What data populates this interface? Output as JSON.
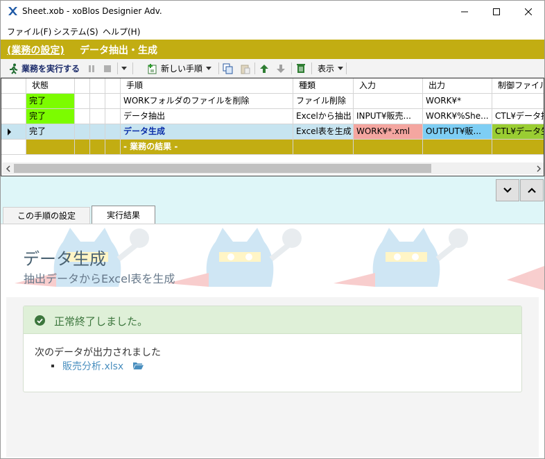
{
  "window": {
    "title": "Sheet.xob - xoBlos Designier Adv."
  },
  "menu": [
    {
      "label": "ファイル(F)"
    },
    {
      "label": "システム(S)"
    },
    {
      "label": "ヘルプ(H)"
    }
  ],
  "header": {
    "link": "(業務の設定)",
    "title": "データ抽出・生成"
  },
  "toolbar": {
    "run_label": "業務を実行する",
    "new_step_label": "新しい手順",
    "view_label": "表示"
  },
  "grid": {
    "columns": [
      "状態",
      "手順",
      "種類",
      "入力",
      "出力",
      "制御ファイル"
    ],
    "rows": [
      {
        "status": "完了",
        "step": "WORKフォルダのファイルを削除",
        "type": "ファイル削除",
        "input": "",
        "output": "WORK¥*",
        "control": ""
      },
      {
        "status": "完了",
        "step": "データ抽出",
        "type": "Excelから抽出",
        "input": "INPUT¥販売...",
        "output": "WORK¥%She...",
        "control": "CTL¥データ抽"
      },
      {
        "status": "完了",
        "step": "データ生成",
        "type": "Excel表を生成",
        "input": "WORK¥*.xml",
        "output": "OUTPUT¥販...",
        "control": "CTL¥データ生"
      }
    ],
    "result_row": "- 業務の結果 -",
    "colors": {
      "done": "#7cfc00",
      "input_hl": "#f4a6a0",
      "output_hl": "#7ecef4",
      "control_hl": "#9acd32"
    }
  },
  "tabs": [
    {
      "label": "この手順の設定"
    },
    {
      "label": "実行結果"
    }
  ],
  "detail": {
    "title": "データ生成",
    "subtitle": "抽出データからExcel表を生成",
    "success_message": "正常終了しました。",
    "output_intro": "次のデータが出力されました",
    "output_file": "販売分析.xlsx"
  }
}
